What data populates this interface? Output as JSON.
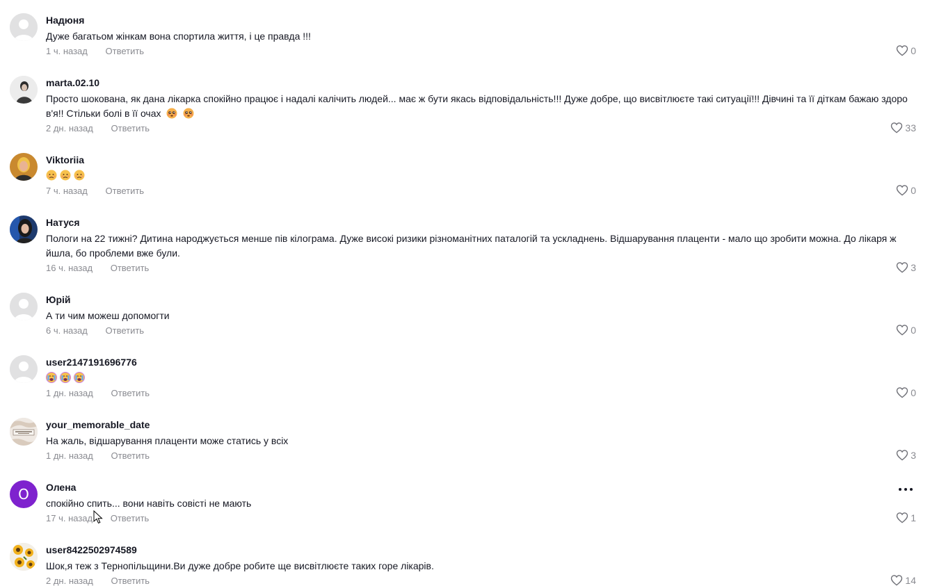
{
  "reply_label": "Ответить",
  "more_icon": "more-horizontal-icon",
  "like_icon": "heart-outline-icon",
  "comments": [
    {
      "username": "Надюня",
      "avatar": "default-avatar",
      "text": "Дуже багатьом жінкам вона спортила життя, і це правда !!!",
      "time": "1 ч. назад",
      "likes": "0"
    },
    {
      "username": "marta.02.10",
      "avatar": "photo-avatar",
      "text": "Просто шокована, як дана лікарка спокійно працює і надалі калічить людей... має ж бути якась відповідальність!!! Дуже добре, що висвітлюєте такі ситуації!!! Дівчині та її діткам бажаю здоро в'я!! Стільки болі в її очах",
      "text_emoji": [
        "pleading-face",
        "pleading-face"
      ],
      "time": "2 дн. назад",
      "likes": "33"
    },
    {
      "username": "Viktoriia",
      "avatar": "photo-avatar",
      "text": "",
      "text_emoji": [
        "sad-face",
        "sad-face",
        "sad-face"
      ],
      "time": "7 ч. назад",
      "likes": "0"
    },
    {
      "username": "Натуся",
      "avatar": "photo-avatar",
      "text": "Пологи на 22 тижні? Дитина народжується менше пів кілограма. Дуже високі ризики різноманітних паталогій та ускладнень. Відшарування плаценти - мало що зробити можна. До лікаря ж йшла, бо проблеми вже були.",
      "time": "16 ч. назад",
      "likes": "3"
    },
    {
      "username": "Юрій",
      "avatar": "default-avatar",
      "text": "А ти чим можеш допомогти",
      "time": "6 ч. назад",
      "likes": "0"
    },
    {
      "username": "user2147191696776",
      "avatar": "default-avatar",
      "text": "",
      "text_emoji": [
        "crying-face",
        "crying-face",
        "crying-face"
      ],
      "time": "1 дн. назад",
      "likes": "0"
    },
    {
      "username": "your_memorable_date",
      "avatar": "logo-avatar",
      "text": "На жаль, відшарування плаценти може статись у всіх",
      "time": "1 дн. назад",
      "likes": "3"
    },
    {
      "username": "Олена",
      "avatar": "letter-avatar",
      "avatar_letter": "О",
      "text": "спокійно спить... вони навіть совісті не мають",
      "time": "17 ч. назад",
      "likes": "1"
    },
    {
      "username": "user8422502974589",
      "avatar": "photo-avatar",
      "text": "Шок,я теж з Тернопільщини.Ви дуже добре робите ще висвітлюєте таких горе лікарів.",
      "time": "2 дн. назад",
      "likes": "14"
    }
  ]
}
